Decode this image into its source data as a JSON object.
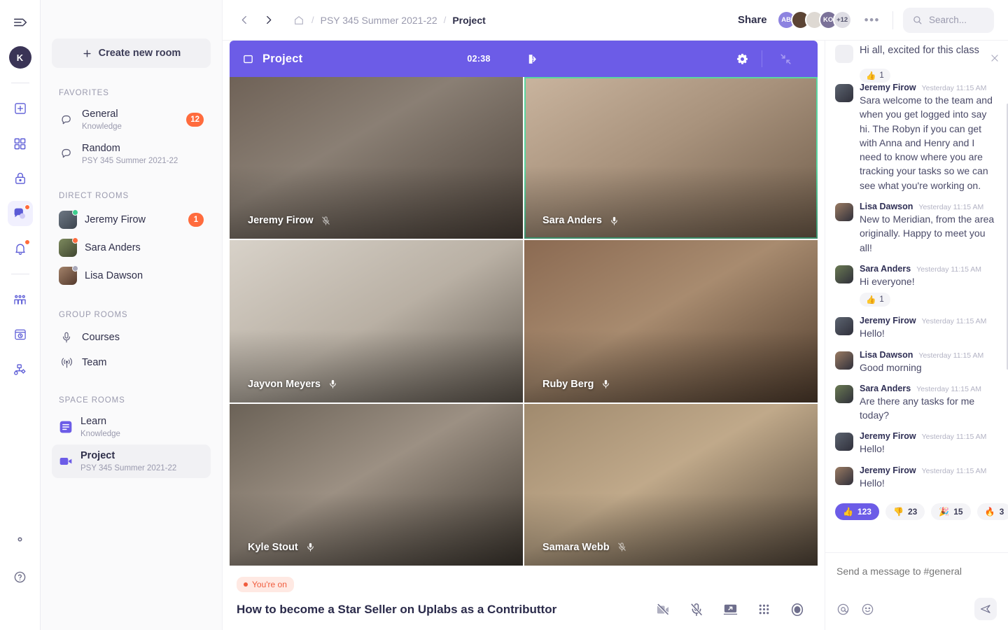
{
  "rail": {
    "toggle_icon": "sidebar-toggle-icon",
    "avatar_initial": "K",
    "items": [
      {
        "name": "add",
        "icon": "plus-square-icon",
        "dot": false
      },
      {
        "name": "apps",
        "icon": "grid-squares-icon",
        "dot": false
      },
      {
        "name": "vault",
        "icon": "lock-icon",
        "dot": false
      },
      {
        "name": "chat",
        "icon": "chat-bubbles-icon",
        "dot": true,
        "active": true
      },
      {
        "name": "notifications",
        "icon": "bell-icon",
        "dot": true
      },
      {
        "name": "people",
        "icon": "people-group-icon",
        "dot": false
      },
      {
        "name": "history",
        "icon": "clock-window-icon",
        "dot": false
      },
      {
        "name": "workflow",
        "icon": "flow-nodes-icon",
        "dot": false
      }
    ],
    "bottom": [
      {
        "name": "settings",
        "icon": "gear-icon"
      },
      {
        "name": "help",
        "icon": "question-circle-icon"
      }
    ]
  },
  "sidebar": {
    "create_label": "Create new room",
    "create_icon": "plus-icon",
    "sections": [
      {
        "label": "FAVORITES",
        "rooms": [
          {
            "name": "General",
            "sub": "Knowledge",
            "icon": "chat-bubble-icon",
            "badge": "12",
            "selected": false
          },
          {
            "name": "Random",
            "sub": "PSY 345 Summer 2021-22",
            "icon": "chat-bubble-icon",
            "badge": "",
            "selected": false
          }
        ]
      },
      {
        "label": "DIRECT ROOMS",
        "rooms": [
          {
            "name": "Jeremy Firow",
            "sub": "",
            "icon": "avatar",
            "badge": "1",
            "presence": "#3ecf8e",
            "selected": false
          },
          {
            "name": "Sara Anders",
            "sub": "",
            "icon": "avatar",
            "badge": "",
            "presence": "#ff6b3d",
            "selected": false
          },
          {
            "name": "Lisa Dawson",
            "sub": "",
            "icon": "avatar",
            "badge": "",
            "presence": "#a8a8ba",
            "selected": false
          }
        ]
      },
      {
        "label": "GROUP ROOMS",
        "rooms": [
          {
            "name": "Courses",
            "sub": "",
            "icon": "microphone-icon",
            "badge": "",
            "selected": false
          },
          {
            "name": "Team",
            "sub": "",
            "icon": "broadcast-icon",
            "badge": "",
            "selected": false
          }
        ]
      },
      {
        "label": "SPACE ROOMS",
        "rooms": [
          {
            "name": "Learn",
            "sub": "Knowledge",
            "icon": "document-square-icon",
            "badge": "",
            "selected": false
          },
          {
            "name": "Project",
            "sub": "PSY 345 Summer 2021-22",
            "icon": "video-square-icon",
            "badge": "",
            "selected": true
          }
        ]
      }
    ]
  },
  "topbar": {
    "back_icon": "chevron-left-icon",
    "forward_icon": "chevron-right-icon",
    "home_icon": "home-icon",
    "breadcrumbs": [
      "PSY 345 Summer 2021-22",
      "Project"
    ],
    "share_label": "Share",
    "avatars": [
      {
        "label": "AB",
        "color": "#8d83e0",
        "photo": false
      },
      {
        "label": "",
        "color": "#5c4434",
        "photo": true
      },
      {
        "label": "",
        "color": "#ded9d3",
        "photo": true
      },
      {
        "label": "KO",
        "color": "#7b7299",
        "photo": false
      },
      {
        "label": "+12",
        "color": "#dedde4",
        "photo": false,
        "text_color": "#55556e"
      }
    ],
    "more_icon": "ellipsis-icon",
    "search_placeholder": "Search...",
    "search_icon": "search-icon"
  },
  "call": {
    "window_icon": "window-icon",
    "title": "Project",
    "timer": "02:38",
    "leave_icon": "leave-call-icon",
    "settings_icon": "gear-icon",
    "minimize_icon": "minimize-icon",
    "accent": "#6c5ce7",
    "participants": [
      {
        "name": "Jeremy Firow",
        "muted": true,
        "speaking": false,
        "bg": "linear-gradient(150deg,#6f6257 0%,#8a7f74 40%,#4a4038 100%)"
      },
      {
        "name": "Sara Anders",
        "muted": false,
        "speaking": true,
        "bg": "linear-gradient(150deg,#c9b49e 0%,#a8927c 45%,#6d5a48 100%)"
      },
      {
        "name": "Jayvon Meyers",
        "muted": false,
        "speaking": false,
        "bg": "linear-gradient(150deg,#d8d2c9 0%,#b9b0a4 50%,#5d554c 100%)"
      },
      {
        "name": "Ruby Berg",
        "muted": false,
        "speaking": false,
        "bg": "linear-gradient(150deg,#8b6a52 0%,#a88b6f 45%,#4e3b2c 100%)"
      },
      {
        "name": "Kyle Stout",
        "muted": false,
        "speaking": false,
        "bg": "linear-gradient(150deg,#6b6257 0%,#9c9083 45%,#3b352e 100%)"
      },
      {
        "name": "Samara Webb",
        "muted": true,
        "speaking": false,
        "bg": "linear-gradient(150deg,#a08a6e 0%,#c0a98a 45%,#4e4236 100%)"
      }
    ],
    "status_label": "You're on",
    "stream_title": "How to become a Star Seller on Uplabs as a Contributtor",
    "controls": [
      {
        "name": "camera-off",
        "icon": "camera-off-icon"
      },
      {
        "name": "mic-off",
        "icon": "mic-off-icon"
      },
      {
        "name": "share-screen",
        "icon": "screen-share-icon"
      },
      {
        "name": "grid-view",
        "icon": "grid-dots-icon"
      },
      {
        "name": "record",
        "icon": "record-icon"
      }
    ]
  },
  "chat": {
    "close_icon": "close-icon",
    "truncated_message": {
      "text": "Hi all, excited for this class",
      "reaction": {
        "emoji": "👍",
        "count": "1"
      }
    },
    "messages": [
      {
        "name": "Jeremy Firow",
        "time": "Yesterday 11:15 AM",
        "text": "Sara welcome to the team and when you get logged into say hi. The Robyn if you can get with Anna and Henry and I need to know where you are tracking your tasks so we can see what you're working on.",
        "avatar": "#5c6470",
        "reaction": null
      },
      {
        "name": "Lisa Dawson",
        "time": "Yesterday 11:15 AM",
        "text": "New to Meridian, from the area originally. Happy to meet you all!",
        "avatar": "#9a7b63",
        "reaction": null
      },
      {
        "name": "Sara Anders",
        "time": "Yesterday 11:15 AM",
        "text": "Hi everyone!",
        "avatar": "#6a7a53",
        "reaction": {
          "emoji": "👍",
          "count": "1"
        }
      },
      {
        "name": "Jeremy Firow",
        "time": "Yesterday 11:15 AM",
        "text": "Hello!",
        "avatar": "#5c6470",
        "reaction": null
      },
      {
        "name": "Lisa Dawson",
        "time": "Yesterday 11:15 AM",
        "text": "Good morning",
        "avatar": "#9a7b63",
        "reaction": null
      },
      {
        "name": "Sara Anders",
        "time": "Yesterday 11:15 AM",
        "text": "Are there any tasks for me today?",
        "avatar": "#6a7a53",
        "reaction": null
      },
      {
        "name": "Jeremy Firow",
        "time": "Yesterday 11:15 AM",
        "text": "Hello!",
        "avatar": "#5c6470",
        "reaction": null
      },
      {
        "name": "Jeremy Firow",
        "time": "Yesterday 11:15 AM",
        "text": "Hello!",
        "avatar": "#9a7b63",
        "reaction": null
      }
    ],
    "reaction_bar": [
      {
        "emoji": "👍",
        "count": "123",
        "active": true
      },
      {
        "emoji": "👎",
        "count": "23",
        "active": false
      },
      {
        "emoji": "🎉",
        "count": "15",
        "active": false
      },
      {
        "emoji": "🔥",
        "count": "3",
        "active": false
      }
    ],
    "composer_placeholder": "Send a message to #general",
    "mention_icon": "at-icon",
    "emoji_icon": "smiley-icon",
    "send_icon": "send-icon"
  }
}
